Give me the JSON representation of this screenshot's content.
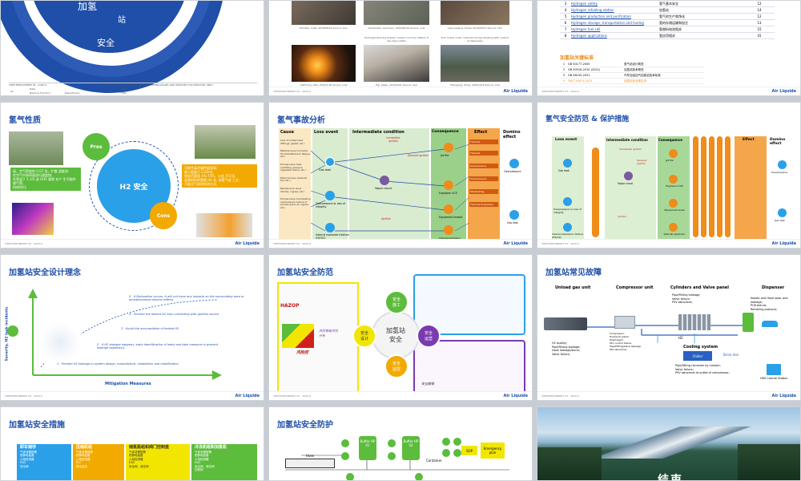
{
  "brand": {
    "logo": "Air Liquide",
    "primary": "#1f4fa8",
    "accent": "#f2a900",
    "green": "#5cbc3c"
  },
  "common": {
    "footer": "TRESTREPONDENT H2 - 2020-0"
  },
  "s1": {
    "ring": [
      "加氢",
      "站",
      "安全"
    ],
    "footer_left": "TREE EMPLOYMENT IN ~2020-0",
    "footer_mid": "AIR LIQUIDE CHAMPS LIMITED TO BASIC TECHNOLOGIES AND SERVICES FOR INDUSTRY AND HEALTH",
    "field1": "Date",
    "field2": "Name & Function",
    "field3": "Department",
    "field4": "Date",
    "field5": "Title",
    "pageno": "01"
  },
  "s2": {
    "captions": [
      "Mumbai, India, 2018/06/01 Source: Link",
      "Gemünden, Germany, 2019/06/10 Source: Link",
      "Liaoyuanjing, China, 2019/05/13 Source: Link",
      "California, USA, 2014/7/18 Source: Link",
      "Fuji, Japan, 2019/4/21 Source: Link",
      "Shenyang, China, 2020/3/16 Source: Link"
    ],
    "notes": [
      "Hydrogen Burning Powder caused in to Fuji. Station 8 ten-days rotate",
      "Fuel mixed route: ruptured during refueling with rupture of dispensers"
    ]
  },
  "s3": {
    "rows": [
      {
        "n": "3",
        "en": "Hydrogen safety",
        "zh": "氢气基本安全",
        "c": "12"
      },
      {
        "n": "4",
        "en": "Hydrogen refueling station",
        "zh": "加氢站",
        "c": "14"
      },
      {
        "n": "5",
        "en": "Hydrogen production and purification",
        "zh": "氢气的生产和净化",
        "c": "12"
      },
      {
        "n": "6",
        "en": "Hydrogen storage, transportation and fueling",
        "zh": "氢的存储运输和加注",
        "c": "13"
      },
      {
        "n": "7",
        "en": "Hydrogen fuel cell",
        "zh": "氢燃料电池相关",
        "c": "15"
      },
      {
        "n": "8",
        "en": "Hydrogen applications",
        "zh": "氢应用相关",
        "c": "41"
      }
    ],
    "std_title": "加氢站关键标准",
    "stds": [
      {
        "n": "1",
        "code": "GB 50177-2005",
        "name": "氢气站设计规范"
      },
      {
        "n": "2",
        "code": "GB 50516-2010 (2021)",
        "name": "加氢站技术规范"
      },
      {
        "n": "3",
        "code": "GB 58155-2021",
        "name": "汽车加油加气加氢站技术标准"
      },
      {
        "n": "4",
        "code": "GB/T 40474-2021",
        "name": "加氢站安全规定求"
      }
    ]
  },
  "s4": {
    "title": "氢气性质",
    "center": "H2 安全",
    "pros": "Pros",
    "cons": "Cons",
    "pros_list": [
      "轻、空气密度的 0.07 倍，扩散 速度快;",
      "在空气中易四面进行速度快;",
      "在常温下 1.2/2 或 GH2 通常 非产 生可能的燃气等;",
      "持续的扫;"
    ],
    "cons_list": [
      "可能性高泄漏性能容易;",
      "着火能量小 0.02mJ;",
      "燃烧范围宽 4%-75%，火焰 不可见;",
      "金属材料的氢脆 H2 发, 液氢气液 工艺;",
      "不能至气体的检测方式;"
    ]
  },
  "s5": {
    "title": "氢气事故分析",
    "headers": [
      "Cause",
      "Loss event",
      "Intermediate condition",
      "Consequence",
      "Effect",
      "Domino effect"
    ],
    "causes": [
      "Loss of containment (Fittings, gasket, etc.)",
      "Material issue (corrosion, H2 embrittlement, fatigue, etc.)",
      "Process issue (leak overfilling, pressure regulation failure, etc.)",
      "External issue (external fire, etc.)",
      "Maintenance issue (facility, ingress, etc.)",
      "Process issue (overheating overpressure rupture of process plant, air ingress etc.)"
    ],
    "nodes": [
      "Gas leak",
      "Vapor cloud",
      "Overpressure or loss of integrity",
      "Internal explosive mixture (H2/O2)"
    ],
    "cons": [
      "Jet fire",
      "Explosion VCE",
      "Equipment breakd",
      "Internal explosion"
    ],
    "ign": [
      "Immediate ignition",
      "Delayed ignition",
      "Ignition"
    ],
    "effects": [
      "Thermal",
      "Thermal",
      "Overpressure",
      "Overpressure",
      "Missile/Frag",
      "Thermal Projectiles"
    ],
    "domino": [
      "Overpressure",
      "Gas leak"
    ]
  },
  "s6": {
    "title": "氢气安全防范 & 保护措施",
    "headers": [
      "Loss event",
      "Intermediate condition",
      "Consequence",
      "Effect",
      "Domino effect"
    ],
    "nodes": [
      "Gas leak",
      "Vapor cloud",
      "Overpressure or loss of integrity",
      "Internal explosive mixture (H2/O2)"
    ],
    "cons": [
      "Jet fire",
      "Explosion VCE",
      "Equipment burst",
      "Internal explosion"
    ],
    "ign": [
      "Immediate ignition",
      "Delayed ignition",
      "Ignition"
    ],
    "domino": [
      "Overpressure",
      "Gas leak"
    ]
  },
  "s7": {
    "title": "加氢站安全设计理念",
    "ylabel": "Severity, H2 leak incidents",
    "xlabel": "Mitigation Measures",
    "steps": [
      "5 - If Detonation occurs, it will not have any impacts on the surrounding area or avoid/minimize domino effects",
      "4 - Prevent the leaked H2 from contacting with ignition source",
      "3 - Avoid the accumulation of leaked H2",
      "2 - If H2 leakage happens, early identification of leaks and take measure to prevent leakage expansion;",
      "1 - Prevent H2 leakage in system design, manufacture, installation and modification"
    ]
  },
  "s8": {
    "title": "加氢站安全防范",
    "center": "加氢站\n安全",
    "petals": [
      "安全\n施工",
      "安全\n设计",
      "安全\n运营",
      "安全\n监控"
    ],
    "labels": [
      "HAZOP",
      "风险控",
      "风险等级评估分析",
      "安全联锁"
    ]
  },
  "s9": {
    "title": "加氢站常见故障",
    "sections": [
      "Unload gas unit",
      "Compressor unit",
      "Cylinders and Valve panel",
      "Dispenser"
    ],
    "dispenser_faults": [
      "Nozzle and Hose wear and leakage;",
      "PCB failure;",
      "Refueling protocol;"
    ],
    "cyl_faults": [
      "Pipe/Fitting leakage;",
      "Valve failure;",
      "PSV abnormal;"
    ],
    "unload_faults": [
      "H2 quality;",
      "Pipe/Fitting leakage;",
      "Hose leakage/burst;",
      "Valve failure;"
    ],
    "comp_faults": [
      "Compressor:",
      "Hydraulic piston",
      "Diaphragm",
      "PLC control failure",
      "Pipe/Fitting/Valve leakage;",
      "PSV abnormal;"
    ],
    "cooling": "Cooling system",
    "cool_faults": [
      "Pipe/fitting corrosion by coolant;",
      "Valve failure;",
      "PSV abnormal at outlet of compressor;"
    ],
    "h2": "H2",
    "brine": "Brine line",
    "chiller": "Chiller",
    "hrs": "HRS Control Station"
  },
  "s10": {
    "title": "加氢站安全措施",
    "cols": [
      {
        "head": "卸车储存",
        "items": [
          "气体泄漏报警",
          "防静电装置",
          "火焰检测器",
          "ESD",
          "安全阀"
        ]
      },
      {
        "head": "压缩机组",
        "items": [
          "气体泄漏报警",
          "防静电装置",
          "火焰检测器",
          "PLC",
          "振动监控"
        ]
      },
      {
        "head": "储氢瓶组和阀门控制盘",
        "items": [
          "气体泄漏报警",
          "防静电装置",
          "火焰检测器",
          "ESD",
          "安全阀，泄压阀"
        ]
      },
      {
        "head": "冷冻机组和加氢机",
        "items": [
          "气体泄漏报警",
          "防静电装置",
          "火焰检测器",
          "ESD",
          "安全阀，泄压阀",
          "拉断阀"
        ]
      }
    ]
  },
  "s11": {
    "title": "加氢站安全防护",
    "buffers": [
      "Buffer HP 01",
      "Buffer HP 02"
    ],
    "container": "Container",
    "sop": "SOP",
    "emergency": "Emergency plan",
    "hose": "Hose"
  },
  "s12": {
    "word": "结束"
  }
}
